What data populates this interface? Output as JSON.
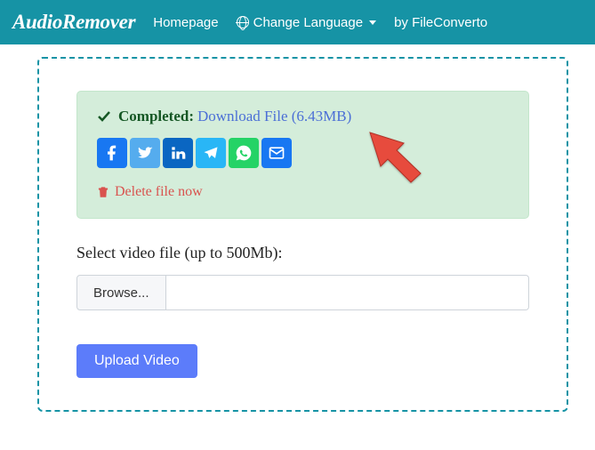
{
  "navbar": {
    "brand": "AudioRemover",
    "homepage": "Homepage",
    "change_language": "Change Language",
    "by_fileconverto": "by FileConverto"
  },
  "status": {
    "completed": "Completed:",
    "download_link": "Download File (6.43MB)"
  },
  "actions": {
    "delete_file": "Delete file now"
  },
  "form": {
    "select_label": "Select video file (up to 500Mb):",
    "browse": "Browse...",
    "upload": "Upload Video"
  },
  "share": {
    "facebook": "facebook",
    "twitter": "twitter",
    "linkedin": "linkedin",
    "telegram": "telegram",
    "whatsapp": "whatsapp",
    "mail": "mail"
  }
}
